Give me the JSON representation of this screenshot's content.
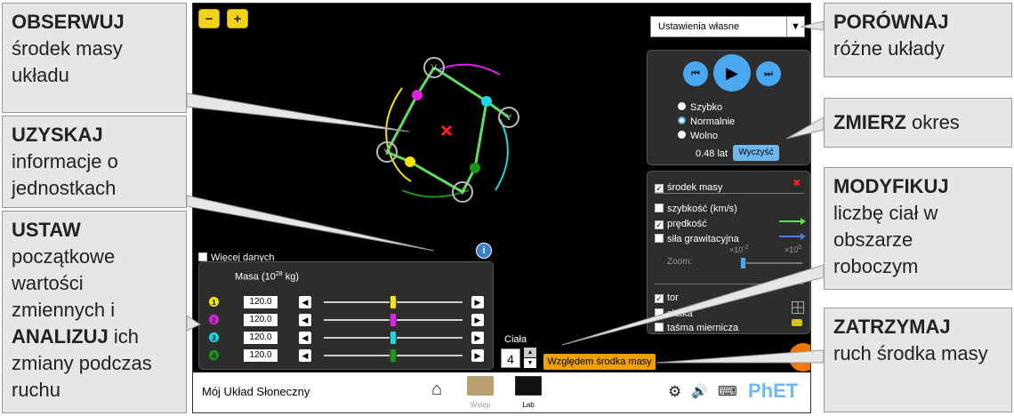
{
  "callouts": {
    "observe": {
      "bold": "OBSERWUJ",
      "text": "środek masy układu"
    },
    "get_info": {
      "bold": "UZYSKAJ",
      "text": "informacje o jednostkach"
    },
    "set": {
      "bold1": "USTAW",
      "text1": " początkowe wartości zmiennych i ",
      "bold2": "ANALIZUJ",
      "text2": " ich zmiany podczas ruchu"
    },
    "compare": {
      "bold": "PORÓWNAJ",
      "text": "różne układy"
    },
    "measure": {
      "bold": "ZMIERZ",
      "text": " okres"
    },
    "modify": {
      "bold": "MODYFIKUJ",
      "text": "liczbę ciał w obszarze roboczym"
    },
    "stop": {
      "bold": "ZATRZYMAJ",
      "text": "ruch środka masy"
    }
  },
  "zoom": {
    "out": "−",
    "in": "+"
  },
  "preset": {
    "value": "Ustawienia własne",
    "arrow": "▼"
  },
  "playback": {
    "speeds": [
      "Szybko",
      "Normalnie",
      "Wolno"
    ],
    "selected": "Normalnie",
    "time": "0.48 lat",
    "clear_label": "Wyczyść"
  },
  "options": {
    "center_of_mass": {
      "label": "środek masy",
      "checked": true
    },
    "speed": {
      "label": "szybkość (km/s)",
      "checked": false
    },
    "velocity": {
      "label": "prędkość",
      "checked": true
    },
    "gravity_force": {
      "label": "siła grawitacyjna",
      "checked": false
    },
    "zoom_label": "Zoom:",
    "zoom_min": "×10",
    "zoom_min_exp": "-2",
    "zoom_max": "×10",
    "zoom_max_exp": "0",
    "path": {
      "label": "tor",
      "checked": true
    },
    "grid": {
      "label": "siatka",
      "checked": false
    },
    "tape": {
      "label": "taśma miernicza",
      "checked": false
    }
  },
  "more_data": {
    "label": "Więcej danych"
  },
  "mass": {
    "title": "Masa (10",
    "title_exp": "28",
    "title_end": " kg)",
    "bodies": [
      {
        "num": "1",
        "value": "120.0",
        "color": "#f5e400",
        "level": 0.5
      },
      {
        "num": "2",
        "value": "120.0",
        "color": "#e020e0",
        "level": 0.5
      },
      {
        "num": "3",
        "value": "120.0",
        "color": "#1ed6e6",
        "level": 0.5
      },
      {
        "num": "4",
        "value": "120.0",
        "color": "#179617",
        "level": 0.5
      }
    ]
  },
  "bodies_count": {
    "label": "Ciała",
    "value": "4"
  },
  "com_button": "Względem środka masy",
  "nav": {
    "title": "Mój Układ Słoneczny",
    "screens": [
      "Wstęp",
      "Lab"
    ],
    "brand": "PhET"
  },
  "colors": {
    "accent": "#f0a000",
    "play_blue": "#4aa8f0"
  }
}
